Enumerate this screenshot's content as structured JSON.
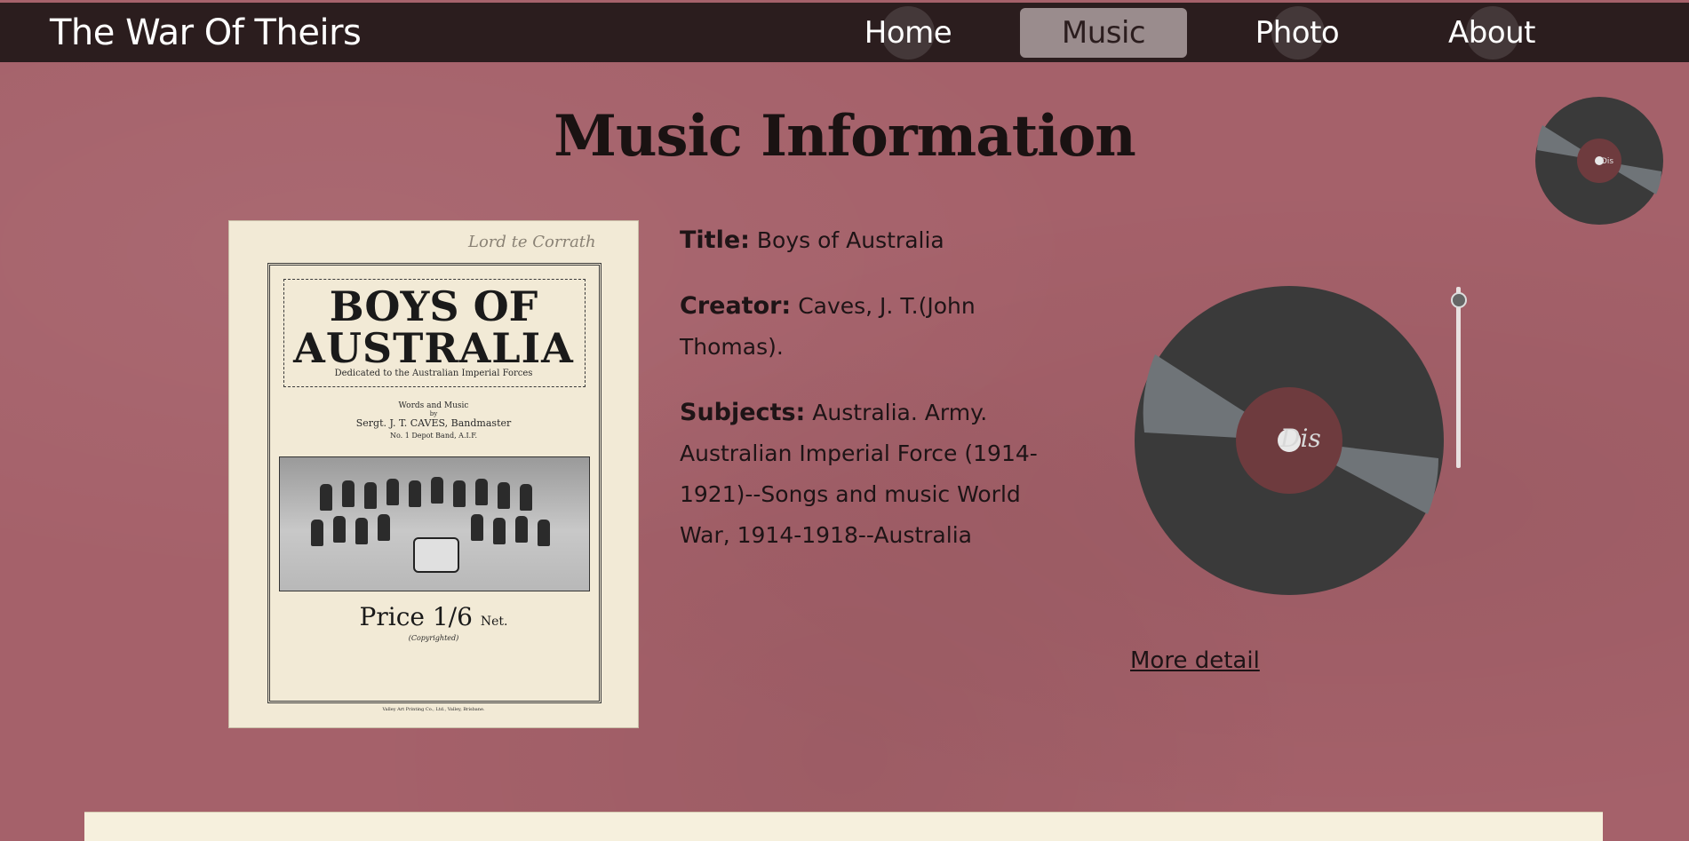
{
  "nav": {
    "brand": "The War Of Theirs",
    "items": [
      {
        "label": "Home",
        "active": false
      },
      {
        "label": "Music",
        "active": true
      },
      {
        "label": "Photo",
        "active": false
      },
      {
        "label": "About",
        "active": false
      }
    ]
  },
  "page": {
    "title": "Music Information"
  },
  "cover": {
    "signature": "Lord te Corrath",
    "title_line1": "BOYS OF",
    "title_line2": "AUSTRALIA",
    "dedication": "Dedicated to the Australian Imperial Forces",
    "words_music": "Words and Music",
    "by": "by",
    "author": "Sergt. J. T. CAVES, Bandmaster",
    "unit": "No. 1 Depot Band, A.I.F.",
    "price": "Price 1/6",
    "price_suffix": "Net.",
    "copyright": "(Copyrighted)",
    "printer": "Valley Art Printing Co., Ltd., Valley, Brisbane."
  },
  "info": {
    "title_label": "Title:",
    "title_value": "Boys of Australia",
    "creator_label": "Creator:",
    "creator_value": "Caves, J. T.(John Thomas).",
    "subjects_label": "Subjects:",
    "subjects_value": "Australia. Army. Australian Imperial Force (1914-1921)--Songs and music World War, 1914-1918--Australia"
  },
  "player": {
    "more_detail": "More detail",
    "disc_label": "Dis",
    "volume_level": 0.95
  },
  "colors": {
    "background": "#a5616a",
    "navbar": "#2b1d1e",
    "active_tab": "#9a8c8d",
    "record": "#3a3a3a",
    "record_center": "#6e3b3e"
  }
}
